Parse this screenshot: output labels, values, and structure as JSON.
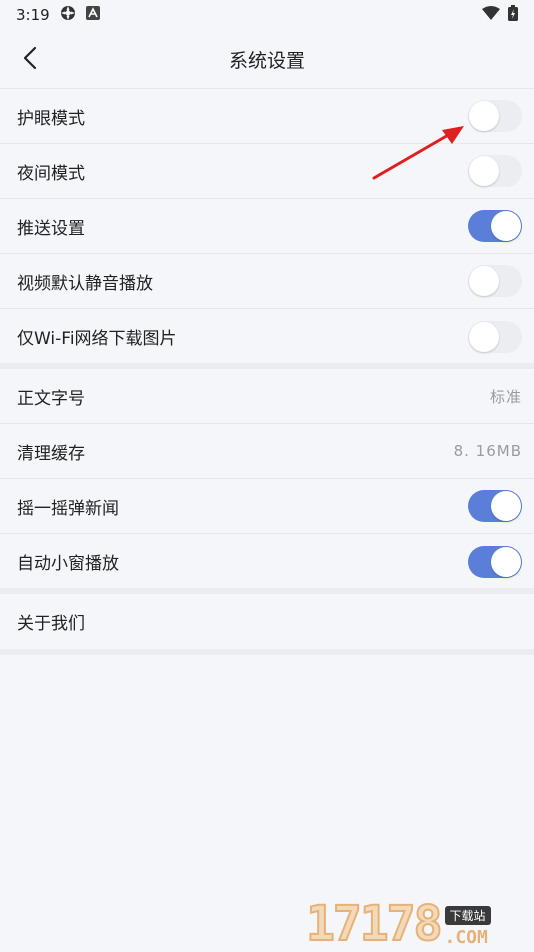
{
  "status_bar": {
    "time": "3:19",
    "icons": [
      "gear-icon",
      "a-icon",
      "wifi-icon",
      "battery-icon"
    ]
  },
  "header": {
    "title": "系统设置",
    "back_icon": "chevron-left-icon"
  },
  "group1": [
    {
      "label": "护眼模式",
      "toggle": false
    },
    {
      "label": "夜间模式",
      "toggle": false
    },
    {
      "label": "推送设置",
      "toggle": true
    },
    {
      "label": "视频默认静音播放",
      "toggle": false
    },
    {
      "label": "仅Wi-Fi网络下载图片",
      "toggle": false
    }
  ],
  "group2": [
    {
      "label": "正文字号",
      "value": "标准"
    },
    {
      "label": "清理缓存",
      "value": "8. 16MB"
    },
    {
      "label": "摇一摇弹新闻",
      "toggle": true
    },
    {
      "label": "自动小窗播放",
      "toggle": true
    }
  ],
  "group3": [
    {
      "label": "关于我们"
    }
  ],
  "watermark": {
    "number": "17178",
    "tag": "下载站",
    "domain": ".COM"
  },
  "colors": {
    "accent": "#5b7fd9",
    "background": "#f5f6fa",
    "annotation_arrow": "#e02020"
  }
}
